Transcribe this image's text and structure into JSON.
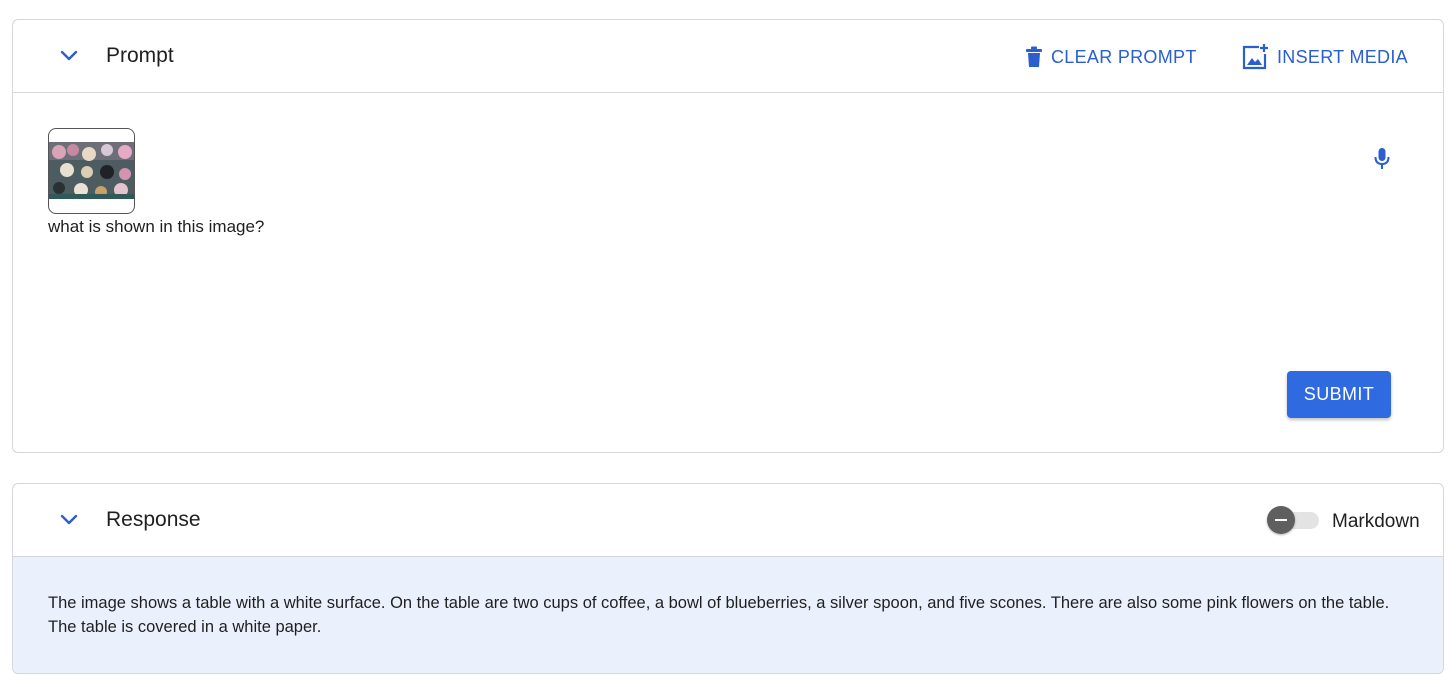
{
  "prompt": {
    "title": "Prompt",
    "clear_label": "CLEAR PROMPT",
    "insert_label": "INSERT MEDIA",
    "text": "what is shown in this image?",
    "submit_label": "SUBMIT"
  },
  "response": {
    "title": "Response",
    "markdown_label": "Markdown",
    "markdown_enabled": false,
    "text": "The image shows a table with a white surface. On the table are two cups of coffee, a bowl of blueberries, a silver spoon, and five scones. There are also some pink flowers on the table. The table is covered in a white paper."
  },
  "icons": {
    "collapse": "chevron-down-icon",
    "clear": "trash-icon",
    "insert": "add-photo-icon",
    "mic": "mic-icon"
  },
  "colors": {
    "accent": "#2a5fd0",
    "submit_bg": "#2f6ae0",
    "response_bg": "#ebf1fc",
    "border": "#d5d7da"
  }
}
